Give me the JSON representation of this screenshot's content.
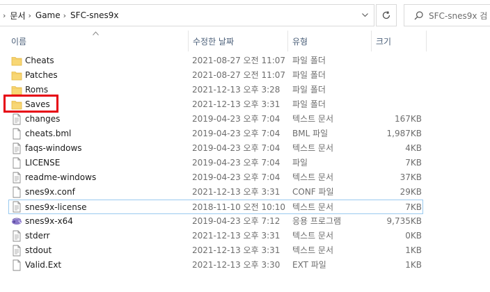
{
  "address": {
    "segments": [
      "문서",
      "Game",
      "SFC-snes9x"
    ]
  },
  "search": {
    "placeholder": "SFC-snes9x 검"
  },
  "columns": {
    "name": "이름",
    "date": "수정한 날짜",
    "type": "유형",
    "size": "크기"
  },
  "files": [
    {
      "name": "Cheats",
      "date": "2021-08-27 오전 11:07",
      "type": "파일 폴더",
      "size": "",
      "icon": "folder"
    },
    {
      "name": "Patches",
      "date": "2021-08-27 오전 11:07",
      "type": "파일 폴더",
      "size": "",
      "icon": "folder"
    },
    {
      "name": "Roms",
      "date": "2021-12-13 오후 3:28",
      "type": "파일 폴더",
      "size": "",
      "icon": "folder"
    },
    {
      "name": "Saves",
      "date": "2021-12-13 오후 3:31",
      "type": "파일 폴더",
      "size": "",
      "icon": "folder"
    },
    {
      "name": "changes",
      "date": "2019-04-23 오후 7:04",
      "type": "텍스트 문서",
      "size": "167KB",
      "icon": "text-file"
    },
    {
      "name": "cheats.bml",
      "date": "2019-04-23 오후 7:04",
      "type": "BML 파일",
      "size": "1,987KB",
      "icon": "file"
    },
    {
      "name": "faqs-windows",
      "date": "2019-04-23 오후 7:04",
      "type": "텍스트 문서",
      "size": "4KB",
      "icon": "text-file"
    },
    {
      "name": "LICENSE",
      "date": "2019-04-23 오후 7:04",
      "type": "파일",
      "size": "7KB",
      "icon": "file"
    },
    {
      "name": "readme-windows",
      "date": "2019-04-23 오후 7:04",
      "type": "텍스트 문서",
      "size": "37KB",
      "icon": "text-file"
    },
    {
      "name": "snes9x.conf",
      "date": "2021-12-13 오후 3:31",
      "type": "CONF 파일",
      "size": "29KB",
      "icon": "file"
    },
    {
      "name": "snes9x-license",
      "date": "2018-11-10 오전 10:10",
      "type": "텍스트 문서",
      "size": "7KB",
      "icon": "text-file"
    },
    {
      "name": "snes9x-x64",
      "date": "2019-04-23 오후 7:12",
      "type": "응용 프로그램",
      "size": "9,735KB",
      "icon": "app"
    },
    {
      "name": "stderr",
      "date": "2021-12-13 오후 3:31",
      "type": "텍스트 문서",
      "size": "0KB",
      "icon": "text-file"
    },
    {
      "name": "stdout",
      "date": "2021-12-13 오후 3:31",
      "type": "텍스트 문서",
      "size": "1KB",
      "icon": "text-file"
    },
    {
      "name": "Valid.Ext",
      "date": "2021-12-13 오후 3:30",
      "type": "EXT 파일",
      "size": "1KB",
      "icon": "file"
    }
  ],
  "focused_index": 10,
  "colors": {
    "highlight": "#e60012",
    "folder": "#f8d775",
    "header_text": "#4c607a",
    "focus_border": "#99c9ef"
  }
}
